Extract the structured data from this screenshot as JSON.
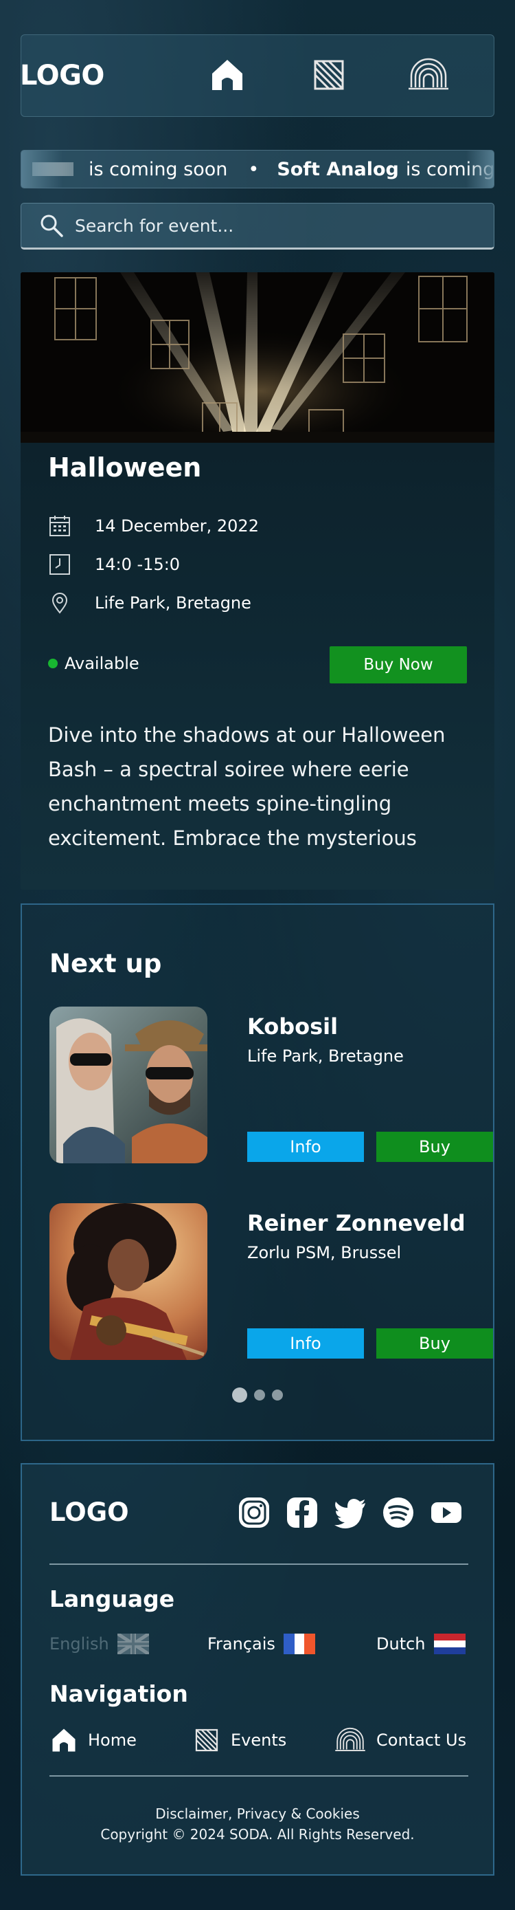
{
  "header": {
    "logo": "LOGO",
    "nav": [
      {
        "icon": "home-icon"
      },
      {
        "icon": "events-icon"
      },
      {
        "icon": "contact-arches-icon"
      }
    ]
  },
  "ticker": {
    "items": [
      {
        "title": "",
        "suffix": "is coming soon"
      },
      {
        "title": "Soft Analog",
        "suffix": "is coming soon"
      }
    ],
    "separator": "•"
  },
  "search": {
    "placeholder": "Search for event..."
  },
  "event": {
    "title": "Halloween",
    "date": "14 December, 2022",
    "time": "14:0 -15:0",
    "location": "Life Park, Bretagne",
    "status": "Available",
    "status_color": "#18b631",
    "buy_label": "Buy Now",
    "description": "Dive into the shadows at our Halloween Bash – a spectral soiree where eerie enchantment meets spine-tingling excitement. Embrace the mysterious"
  },
  "next_up": {
    "title": "Next up",
    "acts": [
      {
        "name": "Kobosil",
        "location": "Life Park, Bretagne",
        "info_label": "Info",
        "buy_label": "Buy"
      },
      {
        "name": "Reiner Zonneveld",
        "location": "Zorlu PSM, Brussel",
        "info_label": "Info",
        "buy_label": "Buy"
      }
    ],
    "pages": 3,
    "current_page": 1
  },
  "footer": {
    "logo": "LOGO",
    "socials": [
      "instagram-icon",
      "facebook-icon",
      "twitter-icon",
      "spotify-icon",
      "youtube-icon"
    ],
    "language_heading": "Language",
    "languages": [
      {
        "label": "English",
        "flag": "uk-flag-icon",
        "active": false
      },
      {
        "label": "Français",
        "flag": "france-flag-icon",
        "active": true
      },
      {
        "label": "Dutch",
        "flag": "netherlands-flag-icon",
        "active": true
      }
    ],
    "navigation_heading": "Navigation",
    "navigation": [
      {
        "label": "Home",
        "icon": "home-icon"
      },
      {
        "label": "Events",
        "icon": "events-icon"
      },
      {
        "label": "Contact Us",
        "icon": "contact-arches-icon"
      }
    ],
    "legal": "Disclaimer, Privacy & Cookies",
    "copyright": "Copyright © 2024 SODA. All Rights Reserved."
  },
  "colors": {
    "buy_green": "#0f8e1e",
    "info_blue": "#0aa6ea",
    "border_blue": "#4696c8"
  }
}
